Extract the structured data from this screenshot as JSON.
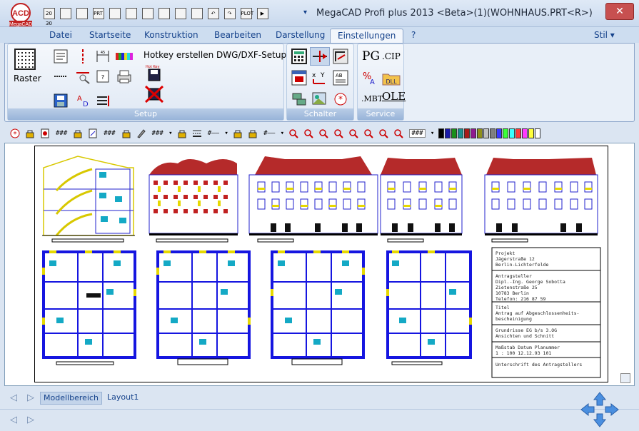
{
  "window": {
    "title": "MegaCAD Profi plus 2013 <Beta>(1)(WOHNHAUS.PRT<R>)",
    "close": "✕",
    "logo_text": "MegaCAD"
  },
  "quick_access": [
    {
      "icon": "units-icon",
      "glyph": "20 30"
    },
    {
      "icon": "new-file-icon",
      "glyph": ""
    },
    {
      "icon": "open-folder-icon",
      "glyph": ""
    },
    {
      "icon": "print-icon",
      "glyph": "PRT"
    },
    {
      "icon": "save-icon",
      "glyph": ""
    },
    {
      "icon": "preview-icon",
      "glyph": ""
    },
    {
      "icon": "page-setup-icon",
      "glyph": ""
    },
    {
      "icon": "color-icon",
      "glyph": ""
    },
    {
      "icon": "properties-icon",
      "glyph": ""
    },
    {
      "icon": "delete-icon",
      "glyph": ""
    },
    {
      "icon": "undo-icon",
      "glyph": "↶"
    },
    {
      "icon": "redo-icon",
      "glyph": "↷"
    },
    {
      "icon": "plot-icon",
      "glyph": "PLOT"
    },
    {
      "icon": "play-icon",
      "glyph": "▶"
    }
  ],
  "tabs": [
    {
      "label": "Datei",
      "active": false
    },
    {
      "label": "Startseite",
      "active": false
    },
    {
      "label": "Konstruktion",
      "active": false
    },
    {
      "label": "Bearbeiten",
      "active": false
    },
    {
      "label": "Darstellung",
      "active": false
    },
    {
      "label": "Einstellungen",
      "active": true
    },
    {
      "label": "?",
      "active": false
    }
  ],
  "style_menu": "Stil ▾",
  "ribbon": {
    "setup": {
      "label": "Setup",
      "raster": "Raster",
      "hotkey": "Hotkey erstellen",
      "dwg": "DWG/DXF-Setup"
    },
    "schalter": {
      "label": "Schalter"
    },
    "service": {
      "label": "Service",
      "pg": "PG",
      "cip": ".CIP",
      "dll": "DLL",
      "mbt": ".MBT",
      "ole": "OLE"
    }
  },
  "toolbar": {
    "hash": "###",
    "colors": [
      "#000000",
      "#1a1aa8",
      "#1a8f1a",
      "#1a8f8f",
      "#a81a1a",
      "#8f1a8f",
      "#8f8f1a",
      "#c0c0c0",
      "#808080",
      "#3a3aff",
      "#3aff3a",
      "#3affff",
      "#ff3a3a",
      "#ff3aff",
      "#ffff3a",
      "#ffffff"
    ]
  },
  "drawing": {
    "titleblock": {
      "projekt_label": "Projekt",
      "projekt_address": "Jägerstraße 12",
      "projekt_city": "Berlin-Lichterfelde",
      "antrag_label": "Antragsteller",
      "antrag_name": "Dipl.-Ing. George Sobotta",
      "antrag_street": "Zietenstraße 25",
      "antrag_city": "10783 Berlin",
      "antrag_phone": "Telefon: 216 87 59",
      "titel_label": "Titel",
      "titel_line1": "Antrag auf Abgeschlossenheits-",
      "titel_line2": "bescheinigung",
      "grund_line1": "Grundrisse EG b/s 3.OG",
      "grund_line2": "Ansichten und Schnitt",
      "mass_header": "Maßstab   Datum    Planummer",
      "mass_values": "1 : 100   12.12.93   101",
      "unterschrift": "Unterschrift des Antragstellers"
    }
  },
  "status": {
    "modellbereich": "Modellbereich",
    "layout1": "Layout1"
  }
}
